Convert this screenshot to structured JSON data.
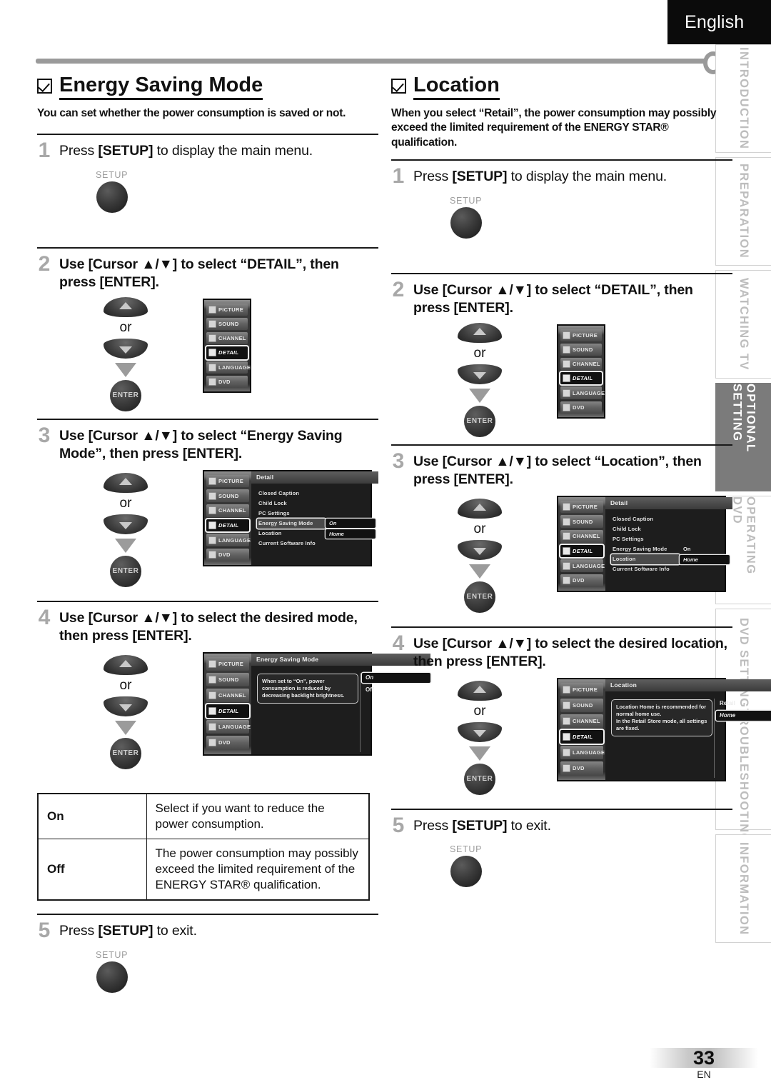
{
  "header": {
    "language_tab": "English"
  },
  "side_tabs": [
    {
      "label": "INTRODUCTION",
      "active": false
    },
    {
      "label": "PREPARATION",
      "active": false
    },
    {
      "label": "WATCHING TV",
      "active": false
    },
    {
      "label": "OPTIONAL SETTING",
      "active": true
    },
    {
      "label": "OPERATING DVD",
      "active": false
    },
    {
      "label": "DVD SETTING",
      "active": false
    },
    {
      "label": "TROUBLESHOOTING",
      "active": false
    },
    {
      "label": "INFORMATION",
      "active": false
    }
  ],
  "left_section": {
    "title": "Energy Saving Mode",
    "description": "You can set whether the power consumption is saved or not.",
    "steps": {
      "s1": {
        "num": "1",
        "text_pre": "Press ",
        "key": "[SETUP]",
        "text_post": " to display the main menu."
      },
      "s2": {
        "num": "2",
        "text": "Use [Cursor ▲/▼] to select “DETAIL”, then press [ENTER]."
      },
      "s3": {
        "num": "3",
        "text": "Use [Cursor ▲/▼] to select “Energy Saving Mode”, then press [ENTER]."
      },
      "s4": {
        "num": "4",
        "text": "Use [Cursor ▲/▼] to select the desired mode, then press [ENTER]."
      },
      "s5": {
        "num": "5",
        "text_pre": "Press ",
        "key": "[SETUP]",
        "text_post": " to exit."
      }
    },
    "table": {
      "rows": [
        {
          "key": "On",
          "desc": "Select if you want to reduce the power consumption."
        },
        {
          "key": "Off",
          "desc": "The power consumption may possibly exceed the limited requirement of the ENERGY STAR® qualification."
        }
      ]
    }
  },
  "right_section": {
    "title": "Location",
    "description": "When you select “Retail”, the power consumption may possibly exceed the limited requirement of the ENERGY STAR® qualification.",
    "steps": {
      "s1": {
        "num": "1",
        "text_pre": "Press ",
        "key": "[SETUP]",
        "text_post": " to display the main menu."
      },
      "s2": {
        "num": "2",
        "text": "Use [Cursor ▲/▼] to select “DETAIL”, then press [ENTER]."
      },
      "s3": {
        "num": "3",
        "text": "Use [Cursor ▲/▼] to select “Location”, then press [ENTER]."
      },
      "s4": {
        "num": "4",
        "text": "Use [Cursor ▲/▼] to select the desired location, then press [ENTER]."
      },
      "s5": {
        "num": "5",
        "text_pre": "Press ",
        "key": "[SETUP]",
        "text_post": " to exit."
      }
    }
  },
  "remote": {
    "setup_label": "SETUP",
    "enter_label": "ENTER",
    "or_label": "or"
  },
  "osd": {
    "menu_items": [
      "PICTURE",
      "SOUND",
      "CHANNEL",
      "DETAIL",
      "LANGUAGE",
      "DVD"
    ],
    "selected_menu": "DETAIL",
    "detail": {
      "title": "Detail",
      "rows": [
        "Closed Caption",
        "Child Lock",
        "PC Settings",
        "Energy Saving Mode",
        "Location",
        "Current Software Info"
      ],
      "values": {
        "energy_saving_mode": "On",
        "location": "Home"
      }
    },
    "energy_saving": {
      "title": "Energy Saving Mode",
      "note": "When set to “On”, power consumption is reduced by decreasing backlight brightness.",
      "choices": [
        "On",
        "Off"
      ],
      "selected": "On"
    },
    "location": {
      "title": "Location",
      "note": "Location Home is recommended for normal home use.\nIn the Retail Store mode, all settings are fixed.",
      "choices": [
        "Retail",
        "Home"
      ],
      "selected": "Home"
    }
  },
  "footer": {
    "page_number": "33",
    "page_code": "EN"
  }
}
